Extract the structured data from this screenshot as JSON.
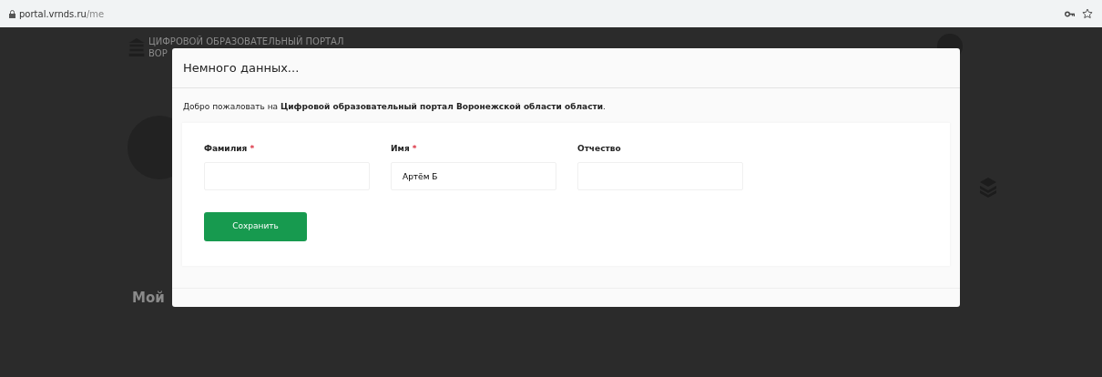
{
  "browser": {
    "url_host": "portal.vrnds.ru",
    "url_path": "/me"
  },
  "background_page": {
    "logo_line_1": "ЦИФРОВОЙ ОБРАЗОВАТЕЛЬНЫЙ ПОРТАЛ",
    "logo_line_2": "ВОР",
    "section_title": "Мой"
  },
  "modal": {
    "title": "Немного данных...",
    "welcome": "Добро пожаловать на **Цифровой образовательный портал Воронежской области области**.",
    "fields": [
      {
        "label": "Фамилия",
        "required": true
      },
      {
        "label": "Имя",
        "required": true,
        "value": "Артём Б"
      },
      {
        "label": "Отчество",
        "required": false
      }
    ],
    "required_mark": "*",
    "save_button": "Сохранить"
  }
}
